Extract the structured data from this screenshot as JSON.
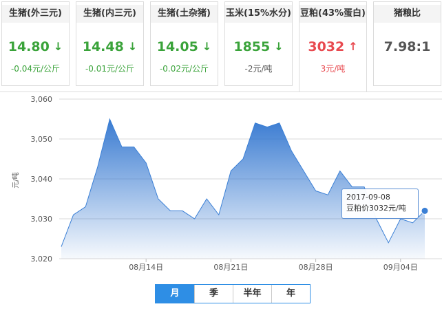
{
  "cards": [
    {
      "name": "生猪(外三元)",
      "price": "14.80",
      "arrow": "↓",
      "change": "-0.04元/公斤",
      "trend": "down"
    },
    {
      "name": "生猪(内三元)",
      "price": "14.48",
      "arrow": "↓",
      "change": "-0.01元/公斤",
      "trend": "down"
    },
    {
      "name": "生猪(土杂猪)",
      "price": "14.05",
      "arrow": "↓",
      "change": "-0.02元/公斤",
      "trend": "down"
    },
    {
      "name": "玉米(15%水分)",
      "price": "1855",
      "arrow": "↓",
      "change": "-2元/吨",
      "trend": "down"
    },
    {
      "name": "豆粕(43%蛋白)",
      "price": "3032",
      "arrow": "↑",
      "change": "3元/吨",
      "trend": "up"
    },
    {
      "name": "猪粮比",
      "price": "7.98:1",
      "arrow": "",
      "change": "",
      "trend": "neutral"
    }
  ],
  "colors": {
    "down": "#3aa33a",
    "up": "#e8494f",
    "accent": "#2e8ee5",
    "series": "#3a7fd5"
  },
  "tooltip": {
    "date": "2017-09-08",
    "text": "豆粕价3032元/吨"
  },
  "tabs": [
    {
      "label": "月",
      "active": true
    },
    {
      "label": "季",
      "active": false
    },
    {
      "label": "半年",
      "active": false
    },
    {
      "label": "年",
      "active": false
    }
  ],
  "chart_data": {
    "type": "area",
    "ylabel": "元/吨",
    "ylim": [
      3020,
      3060
    ],
    "yticks": [
      "3,020",
      "3,030",
      "3,040",
      "3,050",
      "3,060"
    ],
    "xtick_labels": [
      {
        "label": "08月14日",
        "index": 7
      },
      {
        "label": "08月21日",
        "index": 14
      },
      {
        "label": "08月28日",
        "index": 21
      },
      {
        "label": "09月04日",
        "index": 28
      }
    ],
    "x": [
      "08-07",
      "08-08",
      "08-09",
      "08-10",
      "08-11",
      "08-12",
      "08-13",
      "08-14",
      "08-15",
      "08-16",
      "08-17",
      "08-18",
      "08-19",
      "08-20",
      "08-21",
      "08-22",
      "08-23",
      "08-24",
      "08-25",
      "08-26",
      "08-27",
      "08-28",
      "08-29",
      "08-30",
      "08-31",
      "09-01",
      "09-02",
      "09-03",
      "09-04",
      "09-05",
      "09-06",
      "09-07",
      "09-08"
    ],
    "values": [
      3023,
      3031,
      3033,
      3043,
      3055,
      3048,
      3048,
      3044,
      3035,
      3032,
      3032,
      3030,
      3035,
      3031,
      3042,
      3045,
      3054,
      3053,
      3054,
      3047,
      3042,
      3037,
      3036,
      3042,
      3038,
      3038,
      3030,
      3024,
      3030,
      3029,
      3032
    ],
    "grid": true,
    "highlight": {
      "x": "09-08",
      "value": 3032
    }
  }
}
